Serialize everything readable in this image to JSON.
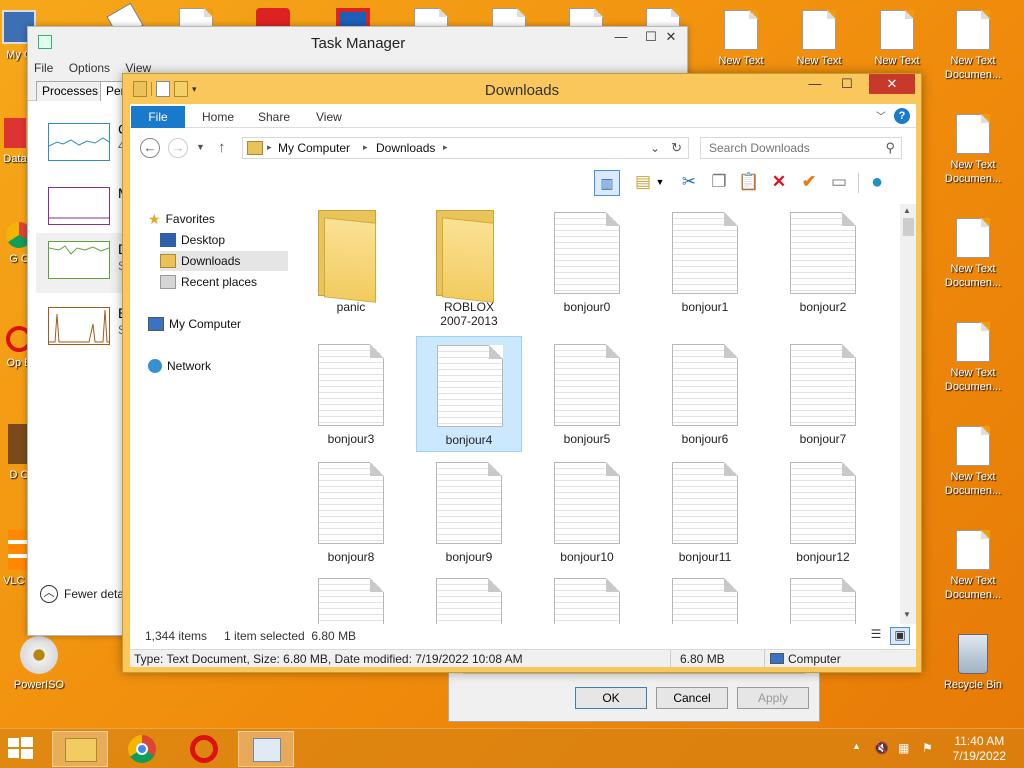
{
  "desktop": {
    "left_icons": [
      "My C",
      "Data",
      "G C",
      "Op B",
      "D C",
      "VLC P",
      "PowerISO"
    ],
    "right_icons_top": [
      "New Text",
      "New Text",
      "New Text",
      "New Text Documen..."
    ],
    "right_icons_col": [
      "New Text Documen...",
      "New Text Documen...",
      "New Text Documen...",
      "New Text Documen...",
      "New Text Documen..."
    ],
    "recycle_bin": "Recycle Bin"
  },
  "task_manager": {
    "title": "Task Manager",
    "menu": [
      "File",
      "Options",
      "View"
    ],
    "tabs": [
      "Processes",
      "Per"
    ],
    "fewer_details": "Fewer deta",
    "perf_letters": [
      "C",
      "M",
      "D",
      "E"
    ],
    "perf_sub": [
      "4",
      "",
      "S",
      "S"
    ]
  },
  "dialog": {
    "ok": "OK",
    "cancel": "Cancel",
    "apply": "Apply"
  },
  "explorer": {
    "title": "Downloads",
    "ribbon_tabs": [
      "File",
      "Home",
      "Share",
      "View"
    ],
    "breadcrumb": [
      "My Computer",
      "Downloads"
    ],
    "search_placeholder": "Search Downloads",
    "nav": {
      "favorites": "Favorites",
      "desktop": "Desktop",
      "downloads": "Downloads",
      "recent": "Recent places",
      "computer": "My Computer",
      "network": "Network"
    },
    "items": [
      {
        "name": "panic",
        "type": "folder"
      },
      {
        "name": "ROBLOX",
        "name2": "2007-2013",
        "type": "folder"
      },
      {
        "name": "bonjour0",
        "type": "file"
      },
      {
        "name": "bonjour1",
        "type": "file"
      },
      {
        "name": "bonjour2",
        "type": "file"
      },
      {
        "name": "bonjour3",
        "type": "file"
      },
      {
        "name": "bonjour4",
        "type": "file",
        "selected": true
      },
      {
        "name": "bonjour5",
        "type": "file"
      },
      {
        "name": "bonjour6",
        "type": "file"
      },
      {
        "name": "bonjour7",
        "type": "file"
      },
      {
        "name": "bonjour8",
        "type": "file"
      },
      {
        "name": "bonjour9",
        "type": "file"
      },
      {
        "name": "bonjour10",
        "type": "file"
      },
      {
        "name": "bonjour11",
        "type": "file"
      },
      {
        "name": "bonjour12",
        "type": "file"
      }
    ],
    "status": {
      "count": "1,344 items",
      "selection": "1 item selected  6.80 MB"
    },
    "details": {
      "info": "Type: Text Document, Size: 6.80 MB, Date modified: 7/19/2022 10:08 AM",
      "size": "6.80 MB",
      "location": "Computer"
    }
  },
  "taskbar": {
    "time": "11:40 AM",
    "date": "7/19/2022"
  },
  "colors": {
    "accent": "#1979ca",
    "explorer_frame": "#f9c75b",
    "close": "#c7392b",
    "selection": "#cce8ff"
  }
}
